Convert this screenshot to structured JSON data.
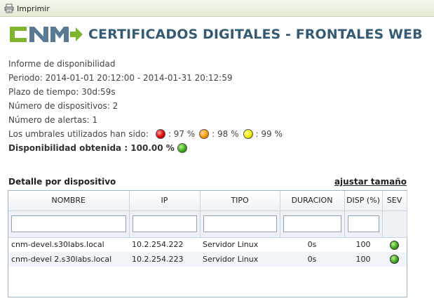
{
  "toolbar": {
    "print_label": "Imprimir",
    "print_icon": "printer-icon"
  },
  "brand": {
    "logo_text": "CNM",
    "title": "CERTIFICADOS DIGITALES - FRONTALES WEB"
  },
  "report": {
    "heading": "Informe de disponibilidad",
    "period": "Periodo: 2014-01-01 20:12:00 - 2014-01-31 20:12:59",
    "timeframe": "Plazo de tiempo: 30d:59s",
    "devices": "Número de dispositivos: 2",
    "alerts": "Número de alertas: 1",
    "thresholds_label": "Los umbrales utilizados han sido:",
    "thresholds": [
      {
        "color": "#e00000",
        "text": ": 97 %"
      },
      {
        "color": "#ff9900",
        "text": ": 98 %"
      },
      {
        "color": "#f5ea00",
        "text": ": 99 %"
      }
    ],
    "availability": "Disponibilidad obtenida : 100.00 %",
    "availability_color": "#3fa91f"
  },
  "detail": {
    "title": "Detalle por dispositivo",
    "resize_link": "ajustar tamaño",
    "columns": [
      "NOMBRE",
      "IP",
      "TIPO",
      "DURACION",
      "DISP (%)",
      "SEV"
    ],
    "filters": [
      "",
      "",
      "",
      "",
      ""
    ],
    "rows": [
      {
        "name": "cnm-devel.s30labs.local",
        "ip": "10.2.254.222",
        "type": "Servidor Linux",
        "duration": "0s",
        "disp": "100",
        "sev_color": "#3fa91f"
      },
      {
        "name": "cnm-devel 2.s30labs.local",
        "ip": "10.2.254.223",
        "type": "Servidor Linux",
        "duration": "0s",
        "disp": "100",
        "sev_color": "#3fa91f"
      }
    ]
  }
}
